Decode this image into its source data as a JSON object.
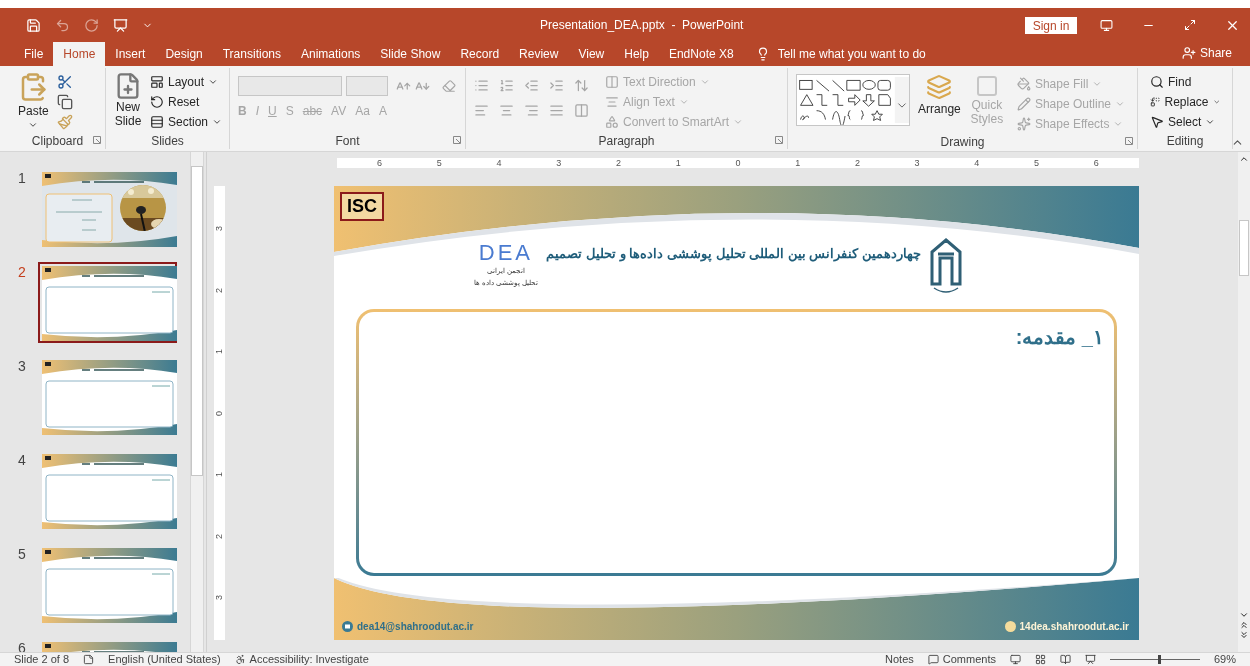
{
  "window": {
    "title": "Presentation_DEA.pptx  -  PowerPoint",
    "sign_in": "Sign in"
  },
  "tabs": [
    {
      "label": "File",
      "selected": false
    },
    {
      "label": "Home",
      "selected": true
    },
    {
      "label": "Insert",
      "selected": false
    },
    {
      "label": "Design",
      "selected": false
    },
    {
      "label": "Transitions",
      "selected": false
    },
    {
      "label": "Animations",
      "selected": false
    },
    {
      "label": "Slide Show",
      "selected": false
    },
    {
      "label": "Record",
      "selected": false
    },
    {
      "label": "Review",
      "selected": false
    },
    {
      "label": "View",
      "selected": false
    },
    {
      "label": "Help",
      "selected": false
    },
    {
      "label": "EndNote X8",
      "selected": false
    }
  ],
  "tell_me": "Tell me what you want to do",
  "share": "Share",
  "ribbon": {
    "groups": [
      {
        "kind": "clipboard",
        "label": "Clipboard",
        "buttons": [
          {
            "label": "Paste",
            "disabled": false
          }
        ]
      },
      {
        "kind": "slides",
        "label": "Slides",
        "buttons": [
          {
            "label": "New Slide",
            "disabled": false
          },
          {
            "label": "Layout",
            "disabled": false
          },
          {
            "label": "Reset",
            "disabled": false
          },
          {
            "label": "Section",
            "disabled": false
          }
        ]
      },
      {
        "kind": "font",
        "label": "Font",
        "formats": [
          {
            "label": "B",
            "disabled": true
          },
          {
            "label": "I",
            "disabled": true
          },
          {
            "label": "U",
            "disabled": true
          },
          {
            "label": "S",
            "disabled": true
          },
          {
            "label": "abc",
            "disabled": true
          },
          {
            "label": "AV",
            "disabled": true
          },
          {
            "label": "Aa",
            "disabled": true
          },
          {
            "label": "A",
            "disabled": true
          }
        ]
      },
      {
        "kind": "paragraph",
        "label": "Paragraph",
        "buttons": [
          {
            "label": "Text Direction",
            "disabled": true
          },
          {
            "label": "Align Text",
            "disabled": true
          },
          {
            "label": "Convert to SmartArt",
            "disabled": true
          }
        ]
      },
      {
        "kind": "drawing",
        "label": "Drawing",
        "buttons": [
          {
            "label": "Arrange",
            "disabled": false
          },
          {
            "label": "Quick Styles",
            "disabled": true
          },
          {
            "label": "Shape Fill",
            "disabled": true
          },
          {
            "label": "Shape Outline",
            "disabled": true
          },
          {
            "label": "Shape Effects",
            "disabled": true
          }
        ]
      },
      {
        "kind": "editing",
        "label": "Editing",
        "buttons": [
          {
            "label": "Find",
            "disabled": false
          },
          {
            "label": "Replace",
            "disabled": false
          },
          {
            "label": "Select",
            "disabled": false
          }
        ]
      }
    ]
  },
  "thumbnails": [
    {
      "number": "1",
      "selected": false,
      "kind": "title"
    },
    {
      "number": "2",
      "selected": true,
      "kind": "content"
    },
    {
      "number": "3",
      "selected": false,
      "kind": "content"
    },
    {
      "number": "4",
      "selected": false,
      "kind": "content"
    },
    {
      "number": "5",
      "selected": false,
      "kind": "content"
    },
    {
      "number": "6",
      "selected": false,
      "kind": "content"
    }
  ],
  "rulers": {
    "horizontal": [
      "6",
      "5",
      "4",
      "3",
      "2",
      "1",
      "0",
      "1",
      "2",
      "3",
      "4",
      "5",
      "6"
    ],
    "vertical": [
      "3",
      "2",
      "1",
      "0",
      "1",
      "2",
      "3"
    ]
  },
  "slide": {
    "isc_logo": "ISC",
    "dea_logo": "DEA",
    "title": "چهاردهمین کنفرانس بین المللی تحلیل پوششی داده‌ها و تحلیل تصمیم",
    "association": [
      "انجمن ایرانی",
      "تحلیل پوششی داده ها"
    ],
    "heading": "۱_ مقدمه:",
    "email": "dea14@shahroodut.ac.ir",
    "website": "14dea.shahroodut.ac.ir"
  },
  "status_bar": {
    "slide": "Slide 2 of 8",
    "language": "English (United States)",
    "accessibility": "Accessibility: Investigate",
    "notes": "Notes",
    "comments": "Comments",
    "zoom": "69%",
    "zoom_slider": {
      "level": 0.55
    }
  }
}
